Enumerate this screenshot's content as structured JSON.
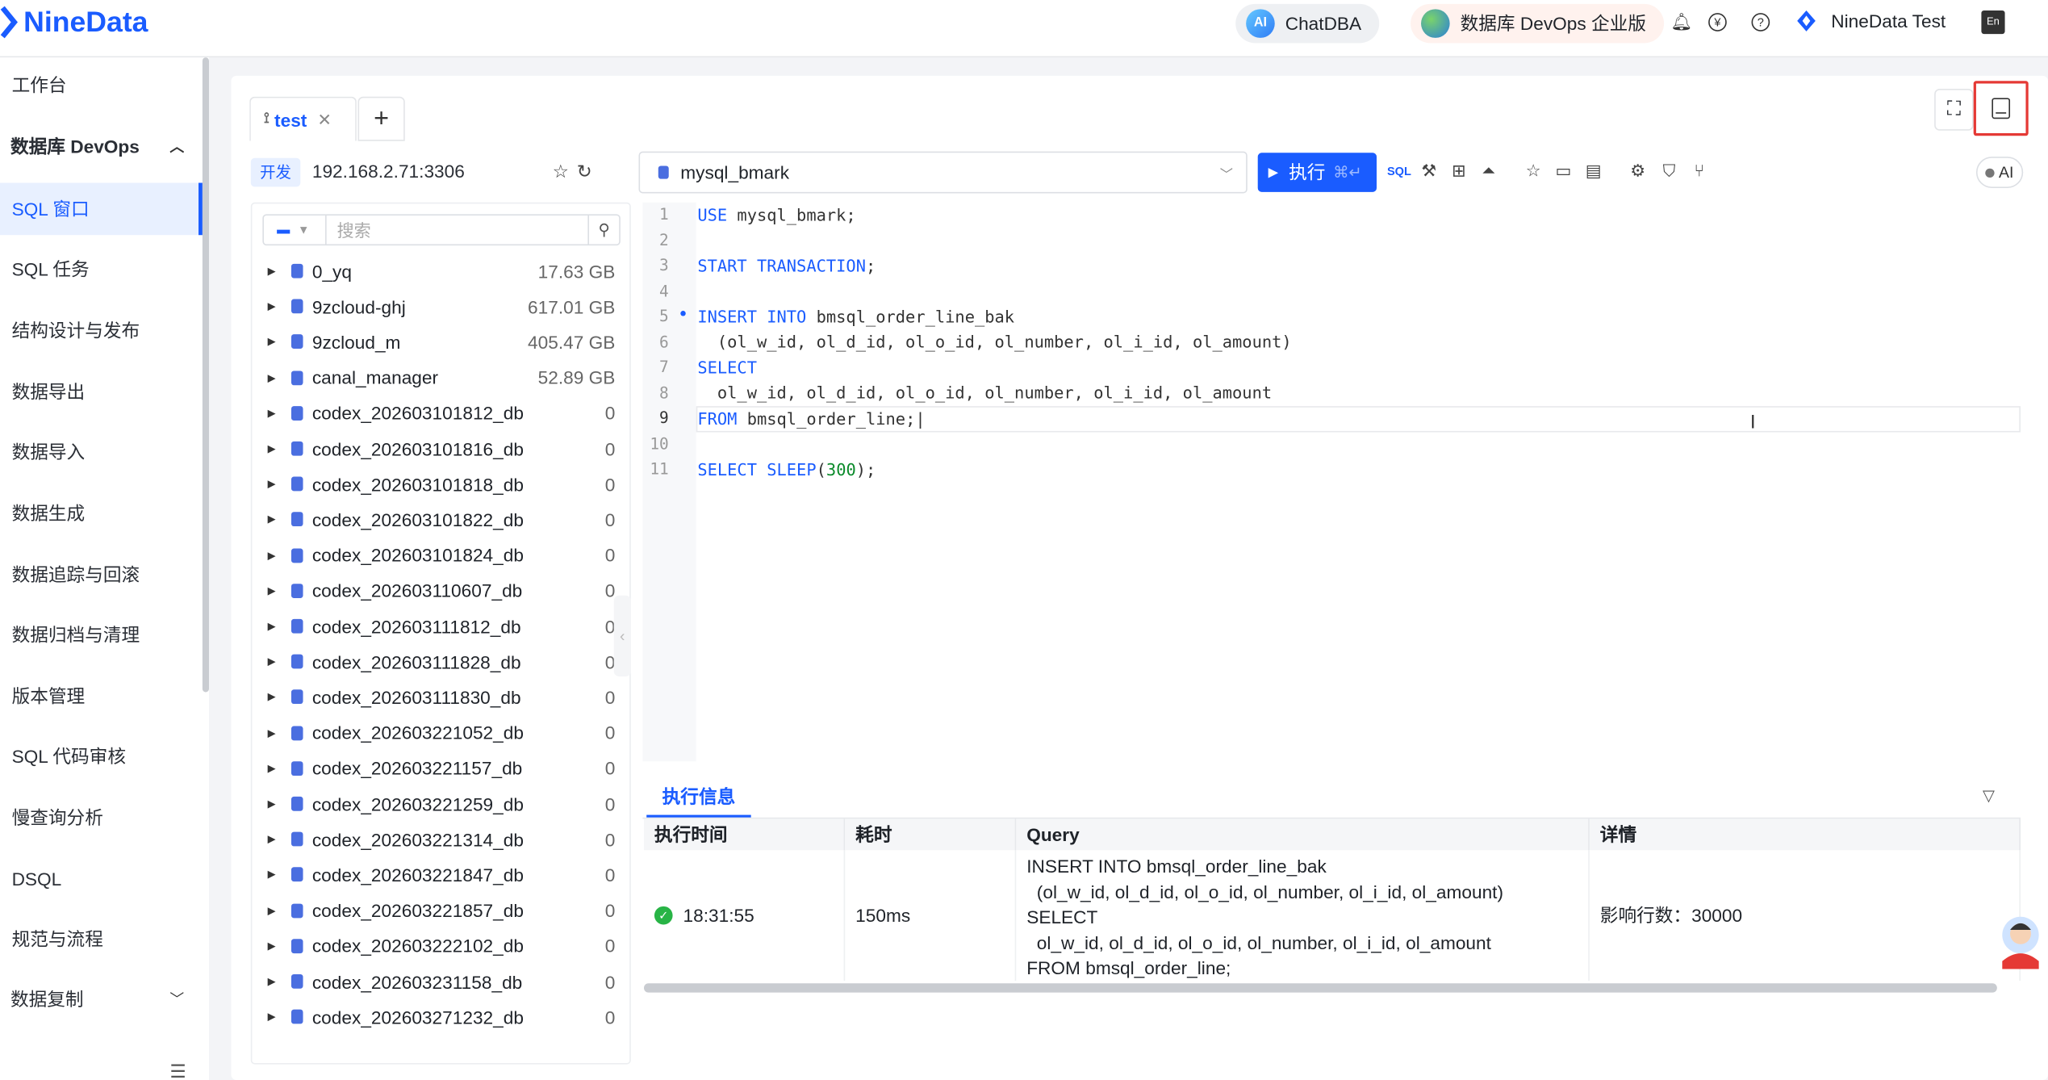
{
  "header": {
    "logo_text": "NineData",
    "chatdba_label": "ChatDBA",
    "devops_label": "数据库 DevOps 企业版",
    "user_label": "NineData Test",
    "lang_label": "En"
  },
  "sidebar": {
    "items": [
      {
        "label": "工作台"
      },
      {
        "label": "数据库 DevOps"
      },
      {
        "label": "SQL 窗口"
      },
      {
        "label": "SQL 任务"
      },
      {
        "label": "结构设计与发布"
      },
      {
        "label": "数据导出"
      },
      {
        "label": "数据导入"
      },
      {
        "label": "数据生成"
      },
      {
        "label": "数据追踪与回滚"
      },
      {
        "label": "数据归档与清理"
      },
      {
        "label": "版本管理"
      },
      {
        "label": "SQL 代码审核"
      },
      {
        "label": "慢查询分析"
      },
      {
        "label": "DSQL"
      },
      {
        "label": "规范与流程"
      },
      {
        "label": "数据复制"
      }
    ]
  },
  "tabs": {
    "active_label": "test",
    "add_label": "+"
  },
  "connection": {
    "env_tag": "开发",
    "address": "192.168.2.71:3306"
  },
  "tree": {
    "search_placeholder": "搜索",
    "databases": [
      {
        "name": "0_yq",
        "size": "17.63 GB"
      },
      {
        "name": "9zcloud-ghj",
        "size": "617.01 GB"
      },
      {
        "name": "9zcloud_m",
        "size": "405.47 GB"
      },
      {
        "name": "canal_manager",
        "size": "52.89 GB"
      },
      {
        "name": "codex_202603101812_db",
        "size": "0"
      },
      {
        "name": "codex_202603101816_db",
        "size": "0"
      },
      {
        "name": "codex_202603101818_db",
        "size": "0"
      },
      {
        "name": "codex_202603101822_db",
        "size": "0"
      },
      {
        "name": "codex_202603101824_db",
        "size": "0"
      },
      {
        "name": "codex_202603110607_db",
        "size": "0"
      },
      {
        "name": "codex_202603111812_db",
        "size": "0"
      },
      {
        "name": "codex_202603111828_db",
        "size": "0"
      },
      {
        "name": "codex_202603111830_db",
        "size": "0"
      },
      {
        "name": "codex_202603221052_db",
        "size": "0"
      },
      {
        "name": "codex_202603221157_db",
        "size": "0"
      },
      {
        "name": "codex_202603221259_db",
        "size": "0"
      },
      {
        "name": "codex_202603221314_db",
        "size": "0"
      },
      {
        "name": "codex_202603221847_db",
        "size": "0"
      },
      {
        "name": "codex_202603221857_db",
        "size": "0"
      },
      {
        "name": "codex_202603222102_db",
        "size": "0"
      },
      {
        "name": "codex_202603231158_db",
        "size": "0"
      },
      {
        "name": "codex_202603271232_db",
        "size": "0"
      }
    ]
  },
  "editor": {
    "database": "mysql_bmark",
    "run_label": "执行",
    "run_shortcut": "⌘↵",
    "ai_label": "AI",
    "lines": [
      "1",
      "2",
      "3",
      "4",
      "5",
      "6",
      "7",
      "8",
      "9",
      "10",
      "11"
    ]
  },
  "result": {
    "tab_label": "执行信息",
    "columns": [
      "执行时间",
      "耗时",
      "Query",
      "详情"
    ],
    "row": {
      "time": "18:31:55",
      "duration": "150ms",
      "query": "INSERT INTO bmsql_order_line_bak\n  (ol_w_id, ol_d_id, ol_o_id, ol_number, ol_i_id, ol_amount)\nSELECT\n  ol_w_id, ol_d_id, ol_o_id, ol_number, ol_i_id, ol_amount\nFROM bmsql_order_line;",
      "detail": "影响行数：30000"
    }
  },
  "colors": {
    "accent": "#1a5cff",
    "highlight_border": "#e53935",
    "success": "#28b446"
  }
}
